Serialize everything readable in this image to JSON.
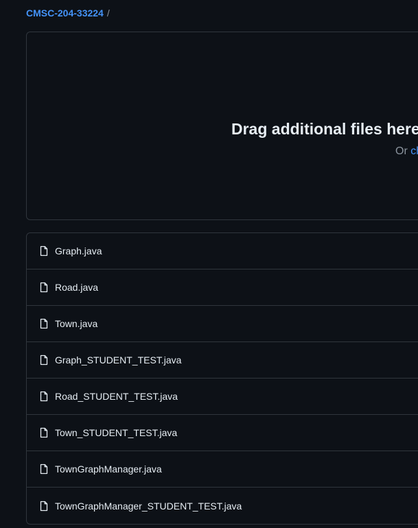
{
  "breadcrumb": {
    "repo": "CMSC-204-33224",
    "separator": "/"
  },
  "dropzone": {
    "title": "Drag additional files here",
    "subtitle_prefix": "Or ",
    "subtitle_link": "ch"
  },
  "files": [
    {
      "name": "Graph.java",
      "icon": "file-icon"
    },
    {
      "name": "Road.java",
      "icon": "file-icon"
    },
    {
      "name": "Town.java",
      "icon": "file-icon"
    },
    {
      "name": "Graph_STUDENT_TEST.java",
      "icon": "file-icon"
    },
    {
      "name": "Road_STUDENT_TEST.java",
      "icon": "file-icon"
    },
    {
      "name": "Town_STUDENT_TEST.java",
      "icon": "file-icon"
    },
    {
      "name": "TownGraphManager.java",
      "icon": "file-icon"
    },
    {
      "name": "TownGraphManager_STUDENT_TEST.java",
      "icon": "file-icon"
    }
  ],
  "colors": {
    "background": "#0d1117",
    "border": "#30363d",
    "link": "#4493f8",
    "text": "#e6edf3",
    "muted": "#8b949e"
  }
}
